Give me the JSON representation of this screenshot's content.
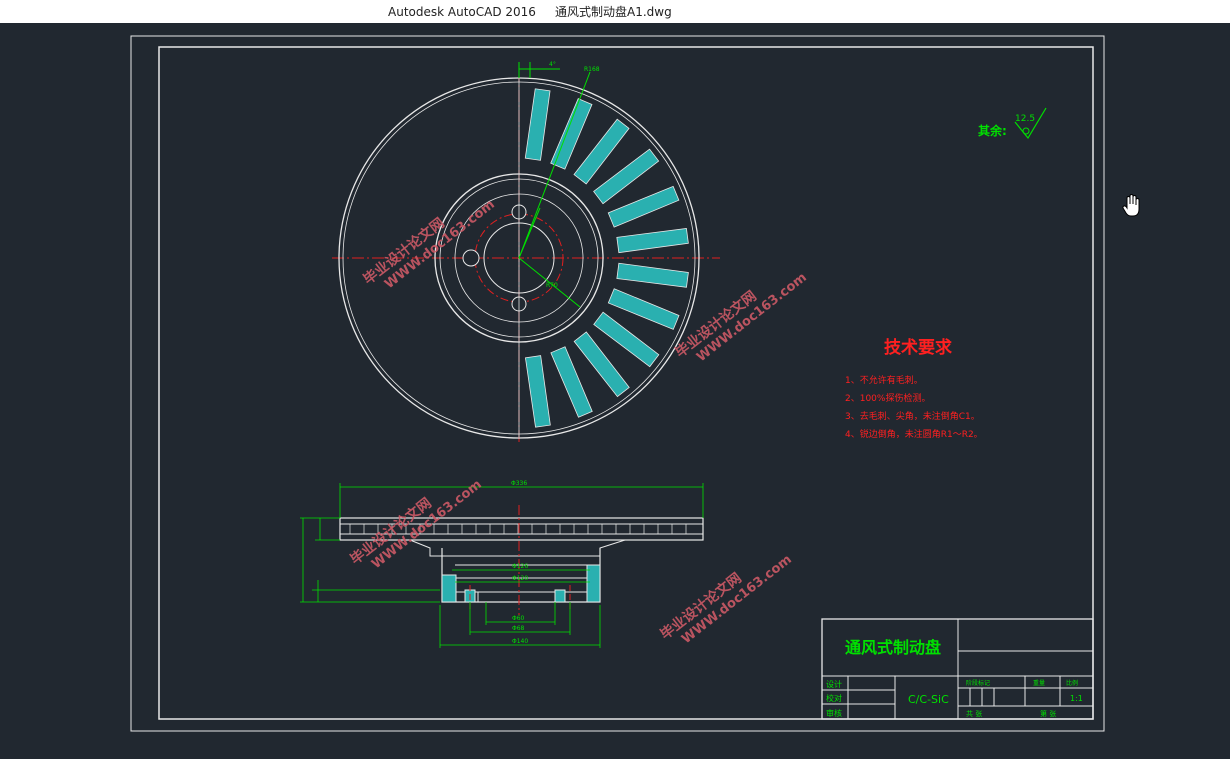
{
  "window": {
    "title": "Autodesk AutoCAD 2016     通风式制动盘A1.dwg"
  },
  "drawing": {
    "surface_note": "其余:",
    "roughness": "12.5",
    "tech_title": "技术要求",
    "tech_items": [
      "1、不允许有毛刺。",
      "2、100%探伤检测。",
      "3、去毛刺、尖角，未注倒角C1。",
      "4、锐边倒角，未注圆角R1～R2。"
    ],
    "watermark": "毕业设计论文网",
    "watermark_url": "WWW.doc163.com",
    "title_block": {
      "part_name": "通风式制动盘",
      "material": "C/C-SiC",
      "row_design": "设计",
      "row_check": "校对",
      "row_approve": "审核",
      "col_stage": "阶段标记",
      "col_weight": "重量",
      "col_scale": "比例",
      "scale": "1:1",
      "sheet_total": "共 张",
      "sheet_no": "第 张"
    },
    "dims": {
      "d_outer": "Φ336",
      "d1": "Φ126",
      "d2": "Φ120",
      "d3": "Φ60",
      "d4": "Φ68",
      "d5": "Φ140",
      "r_vent": "R168",
      "r_hub": "R70",
      "angle": "4°"
    }
  },
  "colors": {
    "background": "#212830",
    "line_white": "#e8e8e8",
    "dim_green": "#00e000",
    "center_red": "#e02020",
    "hatch_cyan": "#2ab0b0",
    "tech_red": "#ff2020"
  }
}
